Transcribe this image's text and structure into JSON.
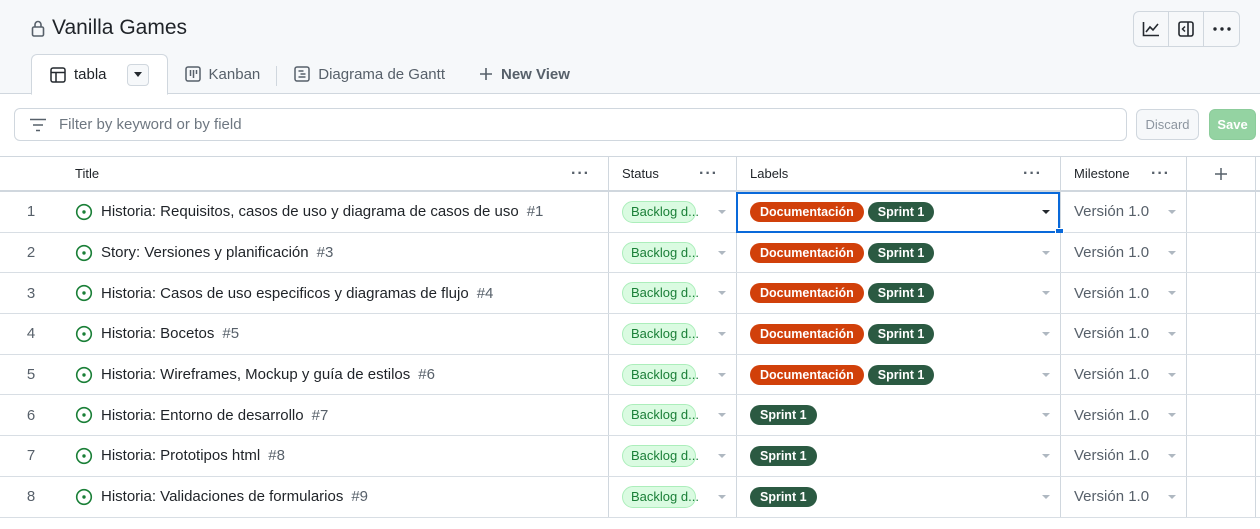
{
  "project": {
    "title": "Vanilla Games"
  },
  "top_actions": {
    "insights": "insights-icon",
    "sidebar": "sidebar-icon",
    "more": "..."
  },
  "tabs": [
    {
      "label": "tabla",
      "icon": "table-icon",
      "active": true
    },
    {
      "label": "Kanban",
      "icon": "board-icon",
      "active": false
    },
    {
      "label": "Diagrama de Gantt",
      "icon": "roadmap-icon",
      "active": false
    }
  ],
  "new_view": {
    "label": "New View"
  },
  "filter": {
    "placeholder": "Filter by keyword or by field"
  },
  "buttons": {
    "discard": "Discard",
    "save": "Save"
  },
  "columns": {
    "title": "Title",
    "status": "Status",
    "labels": "Labels",
    "milestone": "Milestone",
    "add": "+"
  },
  "colors": {
    "accent": "#0969da",
    "doc_label": "#d1400a",
    "sprint_label": "#2b5a42",
    "open_issue": "#1a7f37"
  },
  "rows": [
    {
      "num": "1",
      "title": "Historia: Requisitos, casos de uso y diagrama de casos de uso",
      "issue": "#1",
      "status": "Backlog d...",
      "labels": [
        "Documentación",
        "Sprint 1"
      ],
      "milestone": "Versión 1.0"
    },
    {
      "num": "2",
      "title": "Story: Versiones y planificación",
      "issue": "#3",
      "status": "Backlog d...",
      "labels": [
        "Documentación",
        "Sprint 1"
      ],
      "milestone": "Versión 1.0"
    },
    {
      "num": "3",
      "title": "Historia: Casos de uso especificos y diagramas de flujo",
      "issue": "#4",
      "status": "Backlog d...",
      "labels": [
        "Documentación",
        "Sprint 1"
      ],
      "milestone": "Versión 1.0"
    },
    {
      "num": "4",
      "title": "Historia: Bocetos",
      "issue": "#5",
      "status": "Backlog d...",
      "labels": [
        "Documentación",
        "Sprint 1"
      ],
      "milestone": "Versión 1.0"
    },
    {
      "num": "5",
      "title": "Historia: Wireframes, Mockup y guía de estilos",
      "issue": "#6",
      "status": "Backlog d...",
      "labels": [
        "Documentación",
        "Sprint 1"
      ],
      "milestone": "Versión 1.0"
    },
    {
      "num": "6",
      "title": "Historia: Entorno de desarrollo",
      "issue": "#7",
      "status": "Backlog d...",
      "labels": [
        "Sprint 1"
      ],
      "milestone": "Versión 1.0"
    },
    {
      "num": "7",
      "title": "Historia: Prototipos html",
      "issue": "#8",
      "status": "Backlog d...",
      "labels": [
        "Sprint 1"
      ],
      "milestone": "Versión 1.0"
    },
    {
      "num": "8",
      "title": "Historia: Validaciones de formularios",
      "issue": "#9",
      "status": "Backlog d...",
      "labels": [
        "Sprint 1"
      ],
      "milestone": "Versión 1.0"
    }
  ]
}
